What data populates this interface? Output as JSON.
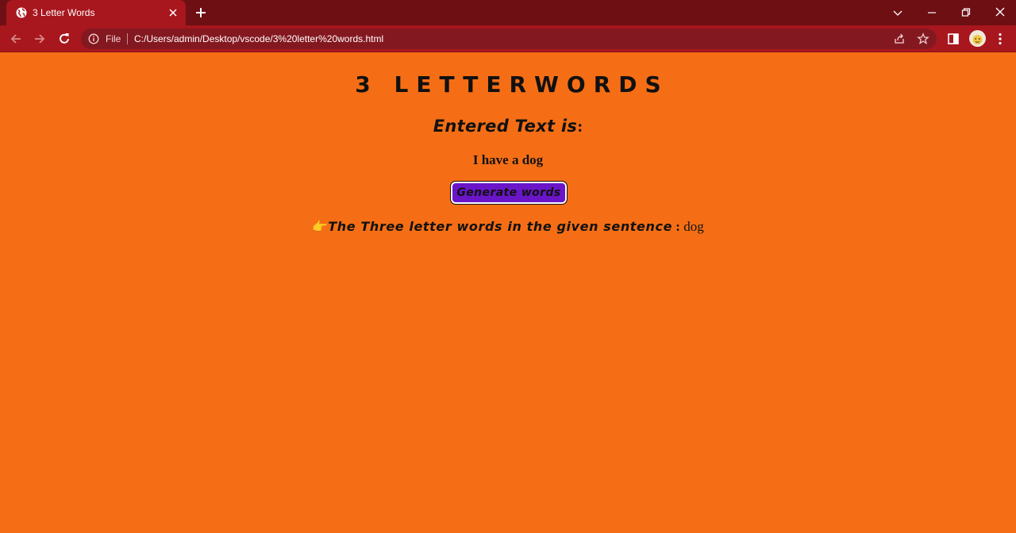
{
  "browser": {
    "tab_title": "3 Letter Words",
    "file_label": "File",
    "url": "C:/Users/admin/Desktop/vscode/3%20letter%20words.html"
  },
  "page": {
    "heading": "3 LETTERWORDS",
    "entered_label": "Entered Text is",
    "entered_colon": ":",
    "entered_value": "I have a dog",
    "generate_button": "Generate words",
    "result_emoji": "👉",
    "result_label": "The Three letter words in the given sentence",
    "result_separator": " : ",
    "result_value": "dog"
  },
  "colors": {
    "page_background": "#f56e15",
    "tabstrip": "#6e0f14",
    "toolbar": "#a8161e",
    "button": "#6a15c8"
  }
}
